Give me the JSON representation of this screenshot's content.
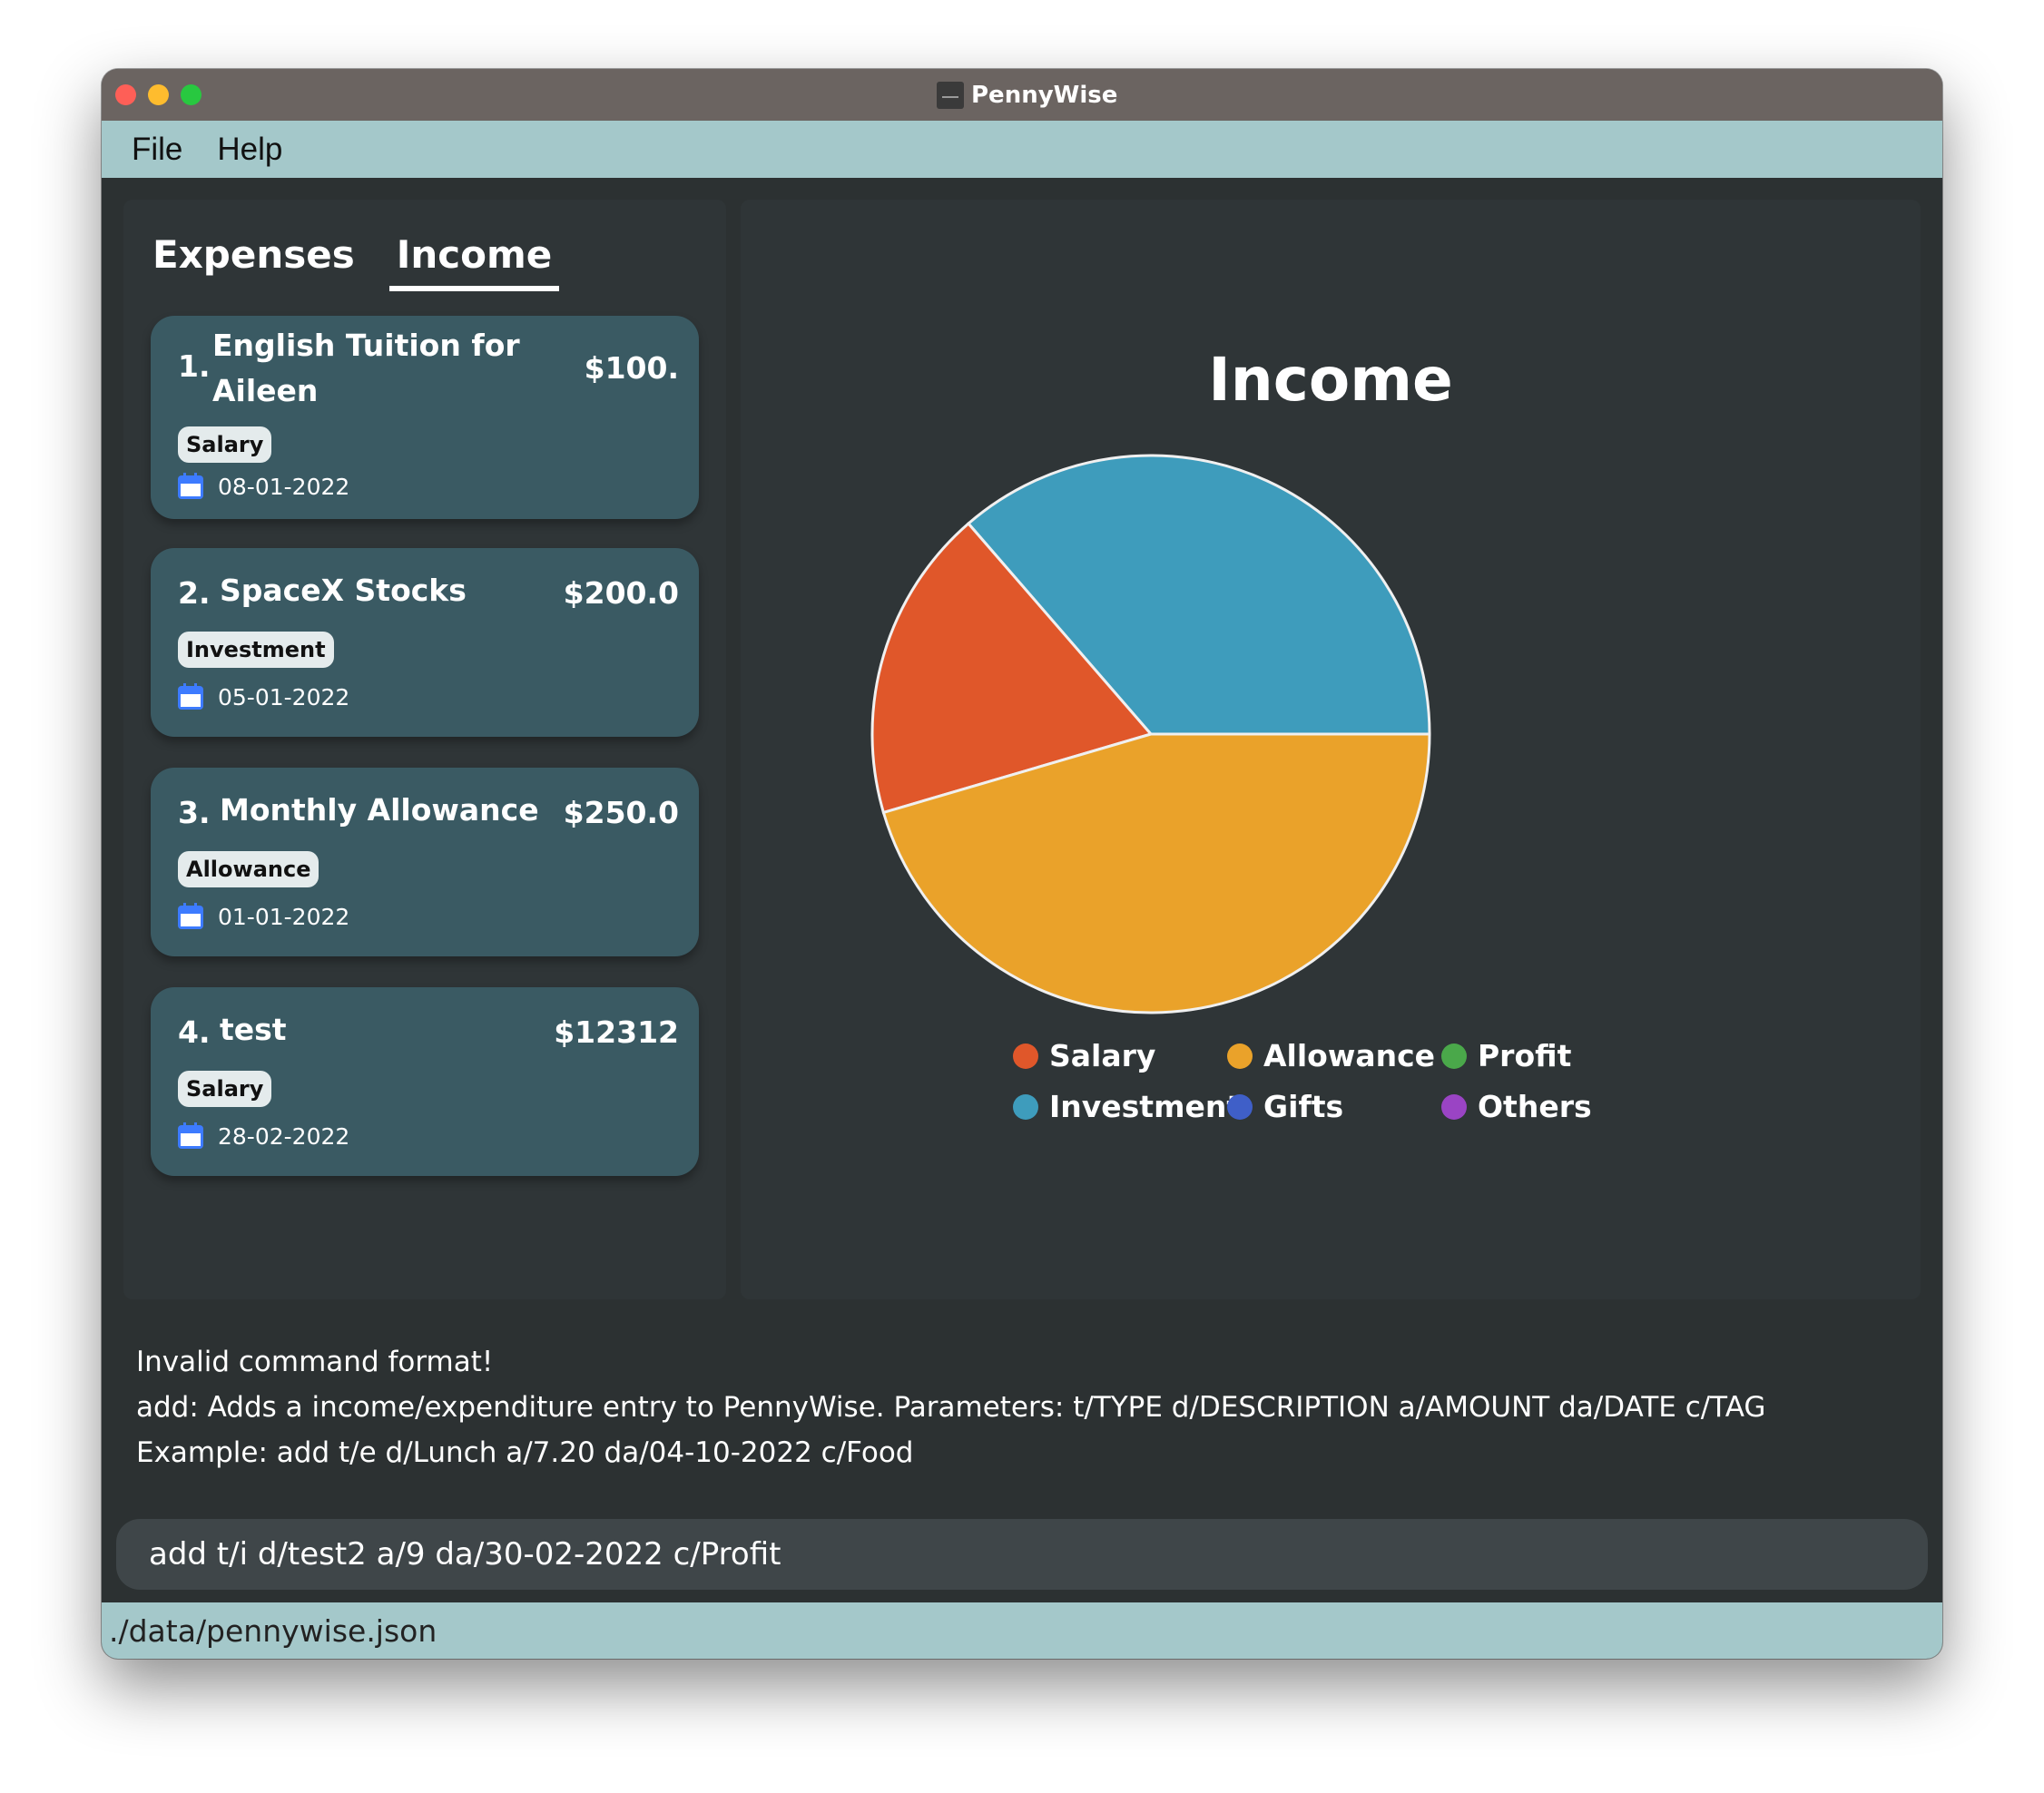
{
  "window": {
    "title": "PennyWise",
    "app_icon": "pennywise-app-icon"
  },
  "menu": {
    "file": "File",
    "help": "Help"
  },
  "tabs": [
    {
      "label": "Expenses",
      "active": false
    },
    {
      "label": "Income",
      "active": true
    }
  ],
  "entries": [
    {
      "index": "1.",
      "description_line1": "English Tuition for",
      "description_line2": "Aileen",
      "amount": "$100.",
      "tag": "Salary",
      "date": "08-01-2022"
    },
    {
      "index": "2.",
      "description_line1": "SpaceX Stocks",
      "amount": "$200.0",
      "tag": "Investment",
      "date": "05-01-2022"
    },
    {
      "index": "3.",
      "description_line1": "Monthly Allowance",
      "amount": "$250.0",
      "tag": "Allowance",
      "date": "01-01-2022"
    },
    {
      "index": "4.",
      "description_line1": "test",
      "amount": "$12312",
      "tag": "Salary",
      "date": "28-02-2022"
    }
  ],
  "chart_data": {
    "type": "pie",
    "title": "Income",
    "slices": [
      {
        "name": "Investment",
        "value": 200,
        "color": "#3e9cbc"
      },
      {
        "name": "Salary",
        "value": 100,
        "color": "#e0572a"
      },
      {
        "name": "Allowance",
        "value": 250,
        "color": "#eaa22a"
      }
    ],
    "legend": [
      {
        "name": "Salary",
        "color": "#e0572a"
      },
      {
        "name": "Allowance",
        "color": "#eaa22a"
      },
      {
        "name": "Profit",
        "color": "#4aa84a"
      },
      {
        "name": "Investment",
        "color": "#3e9cbc"
      },
      {
        "name": "Gifts",
        "color": "#3f5fc8"
      },
      {
        "name": "Others",
        "color": "#9a44c4"
      }
    ],
    "legend_placement": "bottom"
  },
  "result": {
    "line1": "Invalid command format!",
    "line2": "add: Adds a income/expenditure entry to PennyWise. Parameters: t/TYPE d/DESCRIPTION a/AMOUNT da/DATE c/TAG",
    "line3": "Example: add t/e d/Lunch a/7.20 da/04-10-2022 c/Food"
  },
  "command": {
    "value": "add t/i d/test2 a/9 da/30-02-2022 c/Profit"
  },
  "status": {
    "path": "./data/pennywise.json"
  }
}
